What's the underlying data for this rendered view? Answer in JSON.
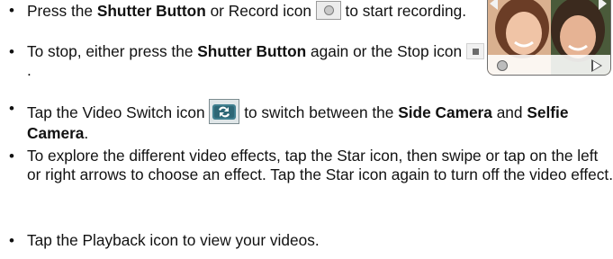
{
  "bullet_char": "•",
  "items": [
    {
      "seg1": "Press the ",
      "bold1": "Shutter Button",
      "seg2": " or Record icon ",
      "icon": "record-icon",
      "seg3": " to start recording."
    },
    {
      "seg1": "To stop, either press the ",
      "bold1": "Shutter Button",
      "seg2": " again or the Stop icon ",
      "icon": "stop-icon",
      "seg3": "."
    },
    {
      "seg1": "Tap the Video Switch icon ",
      "icon": "video-switch-icon",
      "seg2": " to switch between the ",
      "bold1": "Side Camera",
      "seg3": " and ",
      "bold2": "Selfie Camera",
      "seg4": "."
    },
    {
      "text": "To explore the different video effects, tap the Star icon, then swipe or tap on the left or right arrows to choose an effect. Tap the Star icon again to turn off the video effect."
    },
    {
      "text": "Tap the Playback icon to view your videos."
    }
  ],
  "preview": {
    "image": "camera-preview-photo",
    "left_arrow_icon": "left-arrow-icon",
    "right_arrow_icon": "right-arrow-icon",
    "record_icon": "record-icon",
    "play_icon": "play-icon"
  }
}
